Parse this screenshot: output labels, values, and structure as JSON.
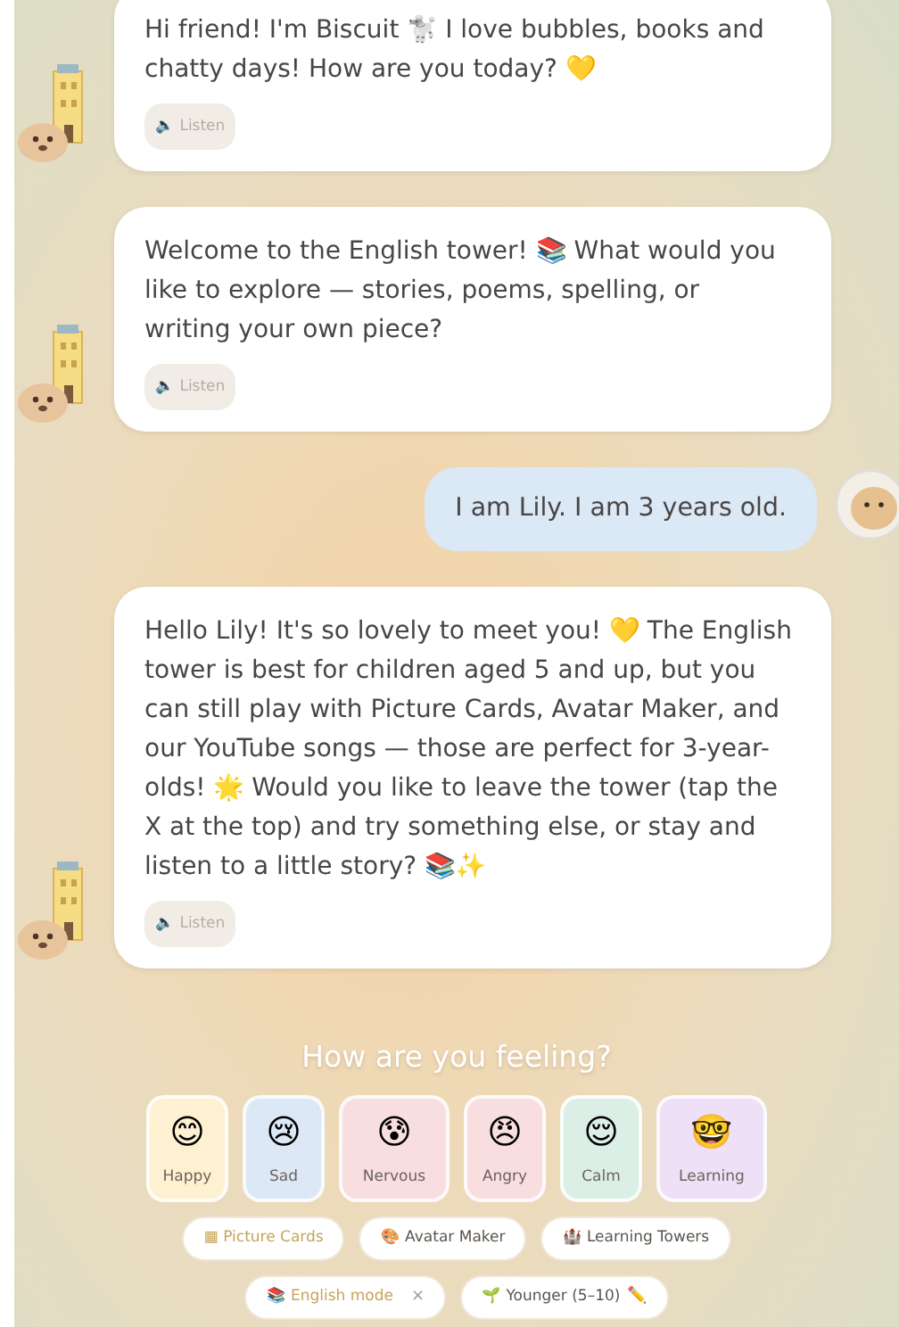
{
  "messages": [
    {
      "kind": "bot",
      "text": "Hi friend! I'm Biscuit 🐩 I love bubbles, books and chatty days! How are you today? 💛",
      "listen": "🔈 Listen"
    },
    {
      "kind": "bot",
      "text": "Welcome to the English tower! 📚 What would you like to explore — stories, poems, spelling, or writing your own piece?",
      "listen": "🔈 Listen"
    },
    {
      "kind": "user",
      "text": "I am Lily. I am 3 years old."
    },
    {
      "kind": "bot",
      "text": "Hello Lily! It's so lovely to meet you! 💛 The English tower is best for children aged 5 and up, but you can still play with Picture Cards, Avatar Maker, and our YouTube songs — those are perfect for 3-year-olds! 🌟 Would you like to leave the tower (tap the X at the top) and try something else, or stay and listen to a little story? 📚✨",
      "listen": "🔈 Listen"
    }
  ],
  "mood_prompt": "How are you feeling?",
  "moods": [
    {
      "emoji": "😊",
      "label": "Happy",
      "color": "#fdf1d2"
    },
    {
      "emoji": "😢",
      "label": "Sad",
      "color": "#dce8f6"
    },
    {
      "emoji": "😰",
      "label": "Nervous",
      "color": "#f8dedf"
    },
    {
      "emoji": "😠",
      "label": "Angry",
      "color": "#f8dedf"
    },
    {
      "emoji": "😌",
      "label": "Calm",
      "color": "#dcefe7"
    },
    {
      "emoji": "🤓",
      "label": "Learning",
      "color": "#eee0f6"
    }
  ],
  "shortcuts": [
    {
      "icon": "▦",
      "label": "Picture Cards",
      "highlighted": true
    },
    {
      "icon": "🎨",
      "label": "Avatar Maker",
      "highlighted": false
    },
    {
      "icon": "🏰",
      "label": "Learning Towers",
      "highlighted": false
    }
  ],
  "settings": [
    {
      "icon": "📚",
      "label": "English mode",
      "action": "×",
      "highlighted": true
    },
    {
      "icon": "🌱",
      "label": "Younger (5–10)",
      "action": "✏️",
      "highlighted": false
    }
  ]
}
